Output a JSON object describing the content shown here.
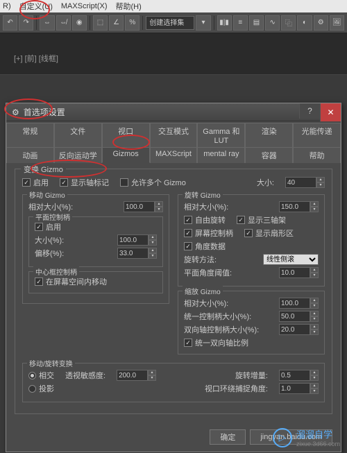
{
  "menubar": {
    "items": [
      "R)",
      "自定义(U)",
      "MAXScript(X)",
      "帮助(H)"
    ]
  },
  "toolbar": {
    "select_label": "创建选择集"
  },
  "viewport": {
    "label": "[+] [前] [线框]"
  },
  "dialog": {
    "title": "首选项设置",
    "tabs_row1": [
      "常规",
      "文件",
      "视口",
      "交互模式",
      "Gamma 和 LUT",
      "渲染",
      "光能传递"
    ],
    "tabs_row2": [
      "动画",
      "反向运动学",
      "Gizmos",
      "MAXScript",
      "mental ray",
      "容器",
      "帮助"
    ],
    "active_tab": "Gizmos",
    "transform_gizmo": {
      "title": "变换 Gizmo",
      "enable": "启用",
      "show_axis": "显示轴标记",
      "allow_multi": "允许多个 Gizmo",
      "size_label": "大小:",
      "size_value": "40"
    },
    "move": {
      "title": "移动 Gizmo",
      "rel_size": "相对大小(%):",
      "rel_size_val": "100.0",
      "plane_title": "平面控制柄",
      "plane_enable": "启用",
      "plane_size": "大小(%):",
      "plane_size_val": "100.0",
      "plane_offset": "偏移(%):",
      "plane_offset_val": "33.0",
      "center_title": "中心框控制柄",
      "center_enable": "在屏幕空间内移动"
    },
    "rotate": {
      "title": "旋转 Gizmo",
      "rel_size": "相对大小(%):",
      "rel_size_val": "150.0",
      "free": "自由旋转",
      "tripod": "显示三轴架",
      "screen": "屏幕控制柄",
      "pie": "显示扇形区",
      "angle_data": "角度数据",
      "method_label": "旋转方法:",
      "method_value": "线性侧滚",
      "planar_thresh": "平面角度阈值:",
      "planar_val": "10.0"
    },
    "scale": {
      "title": "缩放 Gizmo",
      "rel_size": "相对大小(%):",
      "rel_size_val": "100.0",
      "uniform_size": "统一控制柄大小(%):",
      "uniform_val": "50.0",
      "biaxial_size": "双向轴控制柄大小(%):",
      "biaxial_val": "20.0",
      "uniform_biaxial": "统一双向轴比例"
    },
    "mr_transform": {
      "title": "移动/旋转变换",
      "intersect": "相交",
      "persp_sens": "透视敏感度:",
      "persp_val": "200.0",
      "project": "投影",
      "rot_incr": "旋转增量:",
      "rot_val": "0.5",
      "viewport_snap": "视口环绕捕捉角度:",
      "snap_val": "1.0"
    },
    "ok": "确定",
    "cancel": "jingyan.baidu.com"
  },
  "watermark": {
    "text": "溜溜自学",
    "sub": "zixue.3d66.com"
  }
}
